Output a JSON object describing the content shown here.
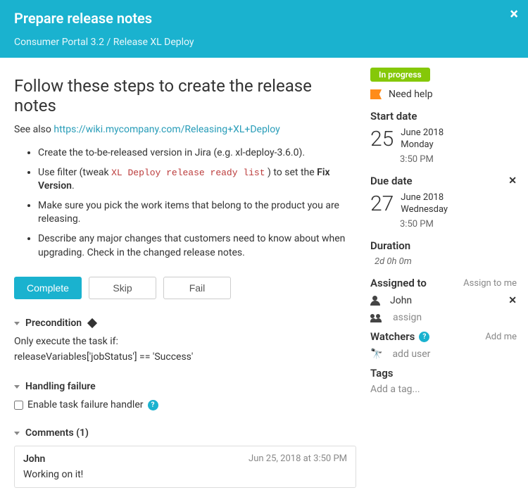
{
  "header": {
    "title": "Prepare release notes",
    "breadcrumb": "Consumer Portal 3.2 / Release XL Deploy"
  },
  "main": {
    "heading": "Follow these steps to create the release notes",
    "see_also_label": "See also",
    "see_also_link": "https://wiki.mycompany.com/Releasing+XL+Deploy",
    "steps": {
      "item1": "Create the to-be-released version in Jira (e.g. xl-deploy-3.6.0).",
      "item2_prefix": "Use filter (tweak ",
      "item2_code": "XL Deploy release ready list",
      "item2_mid": " ) to set the ",
      "item2_bold": "Fix Version",
      "item2_suffix": ".",
      "item3": "Make sure you pick the work items that belong to the product you are releasing.",
      "item4": "Describe any major changes that customers need to know about when upgrading. Check in the changed release notes."
    },
    "buttons": {
      "complete": "Complete",
      "skip": "Skip",
      "fail": "Fail"
    },
    "precondition": {
      "title": "Precondition",
      "intro": "Only execute the task if:",
      "expr": "releaseVariables['jobStatus'] == 'Success'"
    },
    "failure": {
      "title": "Handling failure",
      "checkbox_label": "Enable task failure handler"
    },
    "comments": {
      "title": "Comments (1)",
      "author": "John",
      "date": "Jun 25, 2018 at 3:50 PM",
      "body": "Working on it!"
    }
  },
  "side": {
    "status": "In progress",
    "flag_label": "Need help",
    "start_date": {
      "title": "Start date",
      "day": "25",
      "month_year": "June 2018",
      "weekday": "Monday",
      "time": "3:50 PM"
    },
    "due_date": {
      "title": "Due date",
      "day": "27",
      "month_year": "June 2018",
      "weekday": "Wednesday",
      "time": "3:50 PM"
    },
    "duration": {
      "title": "Duration",
      "value": "2d 0h 0m"
    },
    "assigned": {
      "title": "Assigned to",
      "assign_me": "Assign to me",
      "name": "John",
      "assign_placeholder": "assign"
    },
    "watchers": {
      "title": "Watchers",
      "add_me": "Add me",
      "add_user": "add user"
    },
    "tags": {
      "title": "Tags",
      "placeholder": "Add a tag..."
    }
  }
}
